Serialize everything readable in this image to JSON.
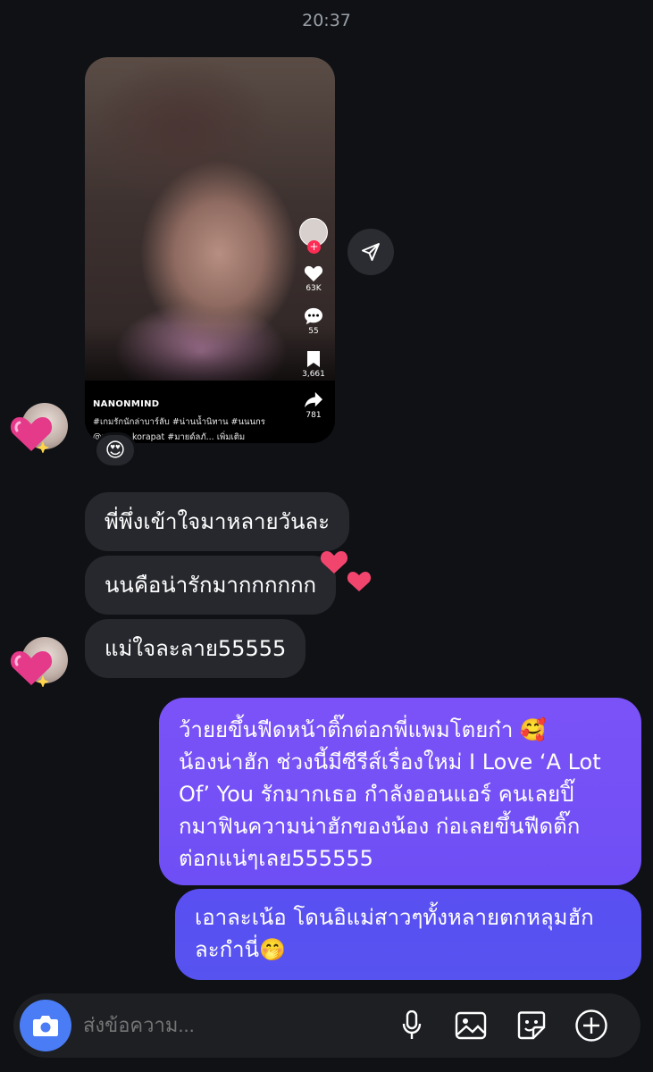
{
  "timestamp": "20:37",
  "shared_video": {
    "creator": "NANONMIND",
    "caption_line1": "#เกมรักนักล่าบาร์ลับ #น่านน้ำนิทาน #นนนกร",
    "caption_line2": "@nanon_korapat #มายด์ลภั... เพิ่มเติม",
    "likes": "63K",
    "comments": "55",
    "saves": "3,661",
    "shares": "781"
  },
  "reaction_emoji": "😍",
  "incoming_messages": [
    {
      "text": "พี่พึ่งเข้าใจมาหลายวันละ"
    },
    {
      "text": "นนคือน่ารักมากกกกกก"
    },
    {
      "text": "แม่ใจละลาย55555"
    }
  ],
  "outgoing_messages": [
    {
      "lines": [
        "ว้ายยขึ้นฟีดหน้าติ๊กต่อกพี่แพมโตยก๋า 🥰",
        "น้องน่าฮัก ช่วงนี้มีซีรีส์เรื่องใหม่ I Love ‘A Lot",
        "Of’ You รักมากเธอ กำลังออนแอร์ คนเลยปิ๊",
        "กมาฟินความน่าฮักของน้อง ก่อเลยขึ้นฟีดติ๊ก",
        "ต่อกแน่ๆเลย555555"
      ]
    },
    {
      "lines": [
        "เอาละเน้อ โดนอิแม่สาวๆทั้งหลายตกหลุมฮัก",
        "ละกำนี่🤭"
      ]
    }
  ],
  "composer": {
    "placeholder": "ส่งข้อความ..."
  },
  "icons": {
    "camera": "camera-icon",
    "mic": "microphone-icon",
    "gallery": "gallery-icon",
    "sticker": "sticker-icon",
    "add": "plus-circle-icon",
    "share": "send-icon"
  },
  "colors": {
    "background": "#0f1115",
    "incoming_bubble": "#26282d",
    "outgoing_bubble_top": "#7b52f7",
    "outgoing_bubble_bottom": "#5653f0",
    "camera_button": "#4a7cf6",
    "heart": "#f2456e"
  }
}
